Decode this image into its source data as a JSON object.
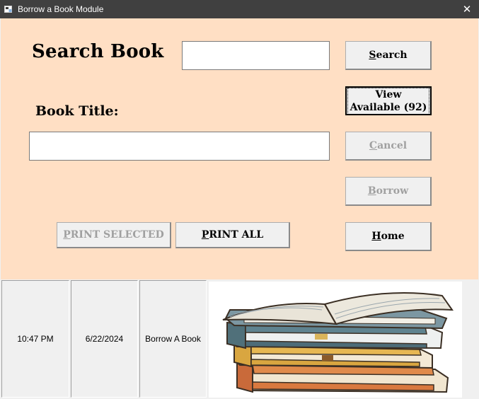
{
  "window": {
    "title": "Borrow a Book Module",
    "close_glyph": "✕"
  },
  "labels": {
    "search_book": "Search Book",
    "book_title": "Book Title:"
  },
  "inputs": {
    "search_value": "",
    "title_value": ""
  },
  "buttons": {
    "search": {
      "first": "S",
      "rest": "earch"
    },
    "view_available": {
      "line1": "View",
      "line2": "Available (92)"
    },
    "cancel": {
      "first": "C",
      "rest": "ancel"
    },
    "borrow": {
      "first": "B",
      "rest": "orrow"
    },
    "home": {
      "first": "H",
      "rest": "ome"
    },
    "print_selected": {
      "first": "P",
      "rest": "RINT SELECTED"
    },
    "print_all": {
      "first": "P",
      "rest": "RINT ALL"
    }
  },
  "status": {
    "time": "10:47 PM",
    "date": "6/22/2024",
    "module": "Borrow A  Book"
  },
  "image": {
    "description": "books-stack-icon"
  }
}
